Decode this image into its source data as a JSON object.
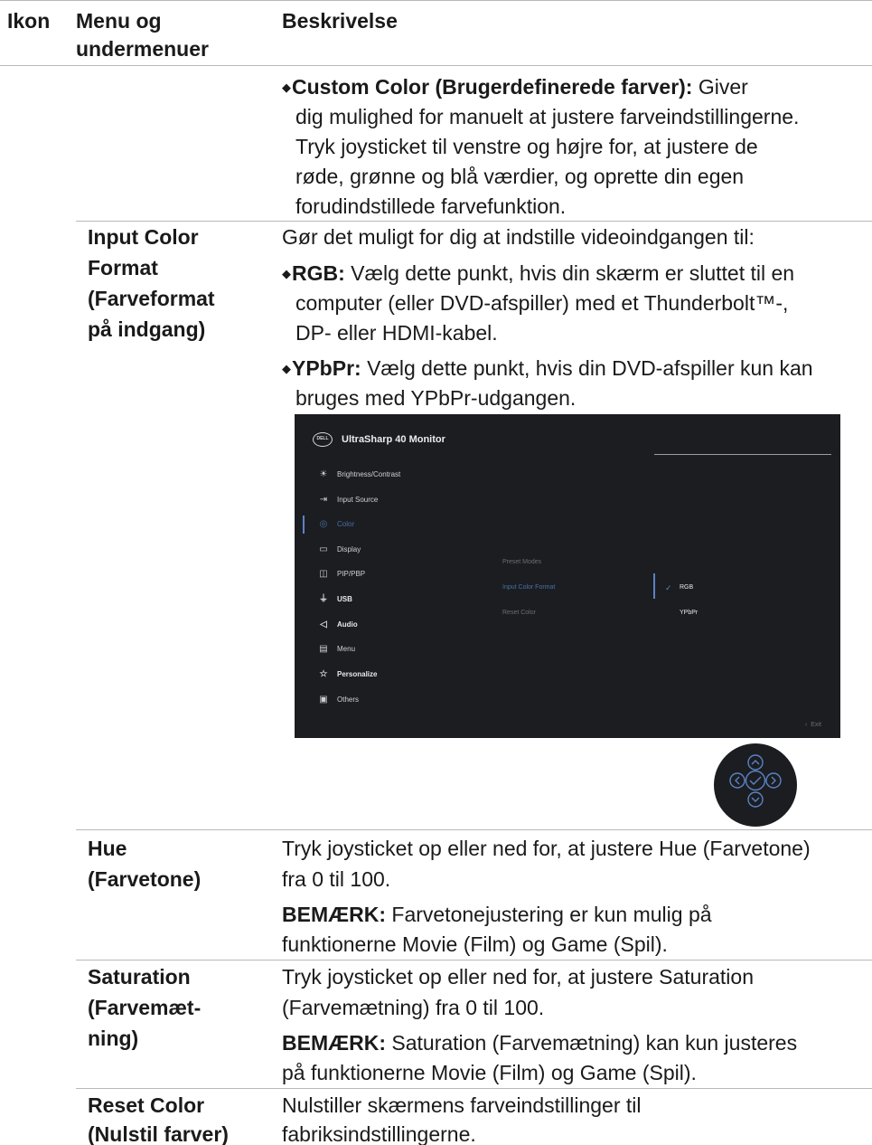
{
  "header": {
    "col_icon": "Ikon",
    "col_menu_line1": "Menu og",
    "col_menu_line2": "undermenuer",
    "col_desc": "Beskrivelse"
  },
  "custom_color": {
    "title": "Custom Color (Brugerdefinerede farver):",
    "lines": [
      "Giver",
      "dig mulighed for manuelt at justere farveindstillingerne.",
      "Tryk joysticket til venstre og højre for, at justere de",
      "røde, grønne og blå værdier, og oprette din egen",
      "forudindstillede farvefunktion."
    ]
  },
  "input_color_format": {
    "name_lines": [
      "Input Color",
      "Format",
      "(Farveformat",
      "på indgang)"
    ],
    "intro": "Gør det muligt for dig at indstille videoindgangen til:",
    "rgb_label": "RGB:",
    "rgb_lines": [
      "Vælg dette punkt, hvis din skærm er sluttet til en",
      "computer (eller DVD-afspiller) med et Thunderbolt™-,",
      "DP- eller HDMI-kabel."
    ],
    "ypbpr_label": "YPbPr:",
    "ypbpr_lines": [
      "Vælg dette punkt, hvis din DVD-afspiller kun kan",
      "bruges med YPbPr-udgangen."
    ]
  },
  "osd": {
    "logo": "DELL",
    "title": "UltraSharp 40 Monitor",
    "menu": [
      {
        "label": "Brightness/Contrast",
        "icon": "brightness-icon"
      },
      {
        "label": "Input Source",
        "icon": "input-source-icon"
      },
      {
        "label": "Color",
        "icon": "color-icon",
        "active": true
      },
      {
        "label": "Display",
        "icon": "display-icon"
      },
      {
        "label": "PIP/PBP",
        "icon": "pip-pbp-icon"
      },
      {
        "label": "USB",
        "icon": "usb-icon",
        "bold": true
      },
      {
        "label": "Audio",
        "icon": "audio-icon",
        "bold": true
      },
      {
        "label": "Menu",
        "icon": "menu-icon"
      },
      {
        "label": "Personalize",
        "icon": "star-icon",
        "bold": true
      },
      {
        "label": "Others",
        "icon": "others-icon"
      }
    ],
    "submenu": [
      "Preset Modes",
      "Input Color Format",
      "Reset Color"
    ],
    "options": [
      "RGB",
      "YPbPr"
    ],
    "exit": "Exit"
  },
  "hue": {
    "name_lines": [
      "Hue",
      "(Farvetone)"
    ],
    "lines": [
      "Tryk joysticket op eller ned for, at justere Hue (Farvetone)",
      "fra 0 til 100."
    ],
    "note_label": "BEMÆRK:",
    "note_lines": [
      "Farvetonejustering er kun mulig på",
      "funktionerne Movie (Film) og Game (Spil)."
    ]
  },
  "saturation": {
    "name_lines": [
      "Saturation",
      "(Farvemæt-",
      "ning)"
    ],
    "lines": [
      "Tryk joysticket op eller ned for, at justere Saturation",
      "(Farvemætning) fra 0 til 100."
    ],
    "note_label": "BEMÆRK:",
    "note_lines": [
      "Saturation (Farvemætning) kan kun justeres",
      "på funktionerne Movie (Film) og Game (Spil)."
    ]
  },
  "reset_color": {
    "name_lines": [
      "Reset Color",
      "(Nulstil farver)"
    ],
    "lines": [
      "Nulstiller skærmens farveindstillinger til",
      "fabriksindstillingerne."
    ]
  },
  "colors": {
    "text": "#1a1a1a",
    "rule": "#b8b8b8",
    "osd_bg": "#1b1d21",
    "osd_accent": "#5b83c4"
  }
}
